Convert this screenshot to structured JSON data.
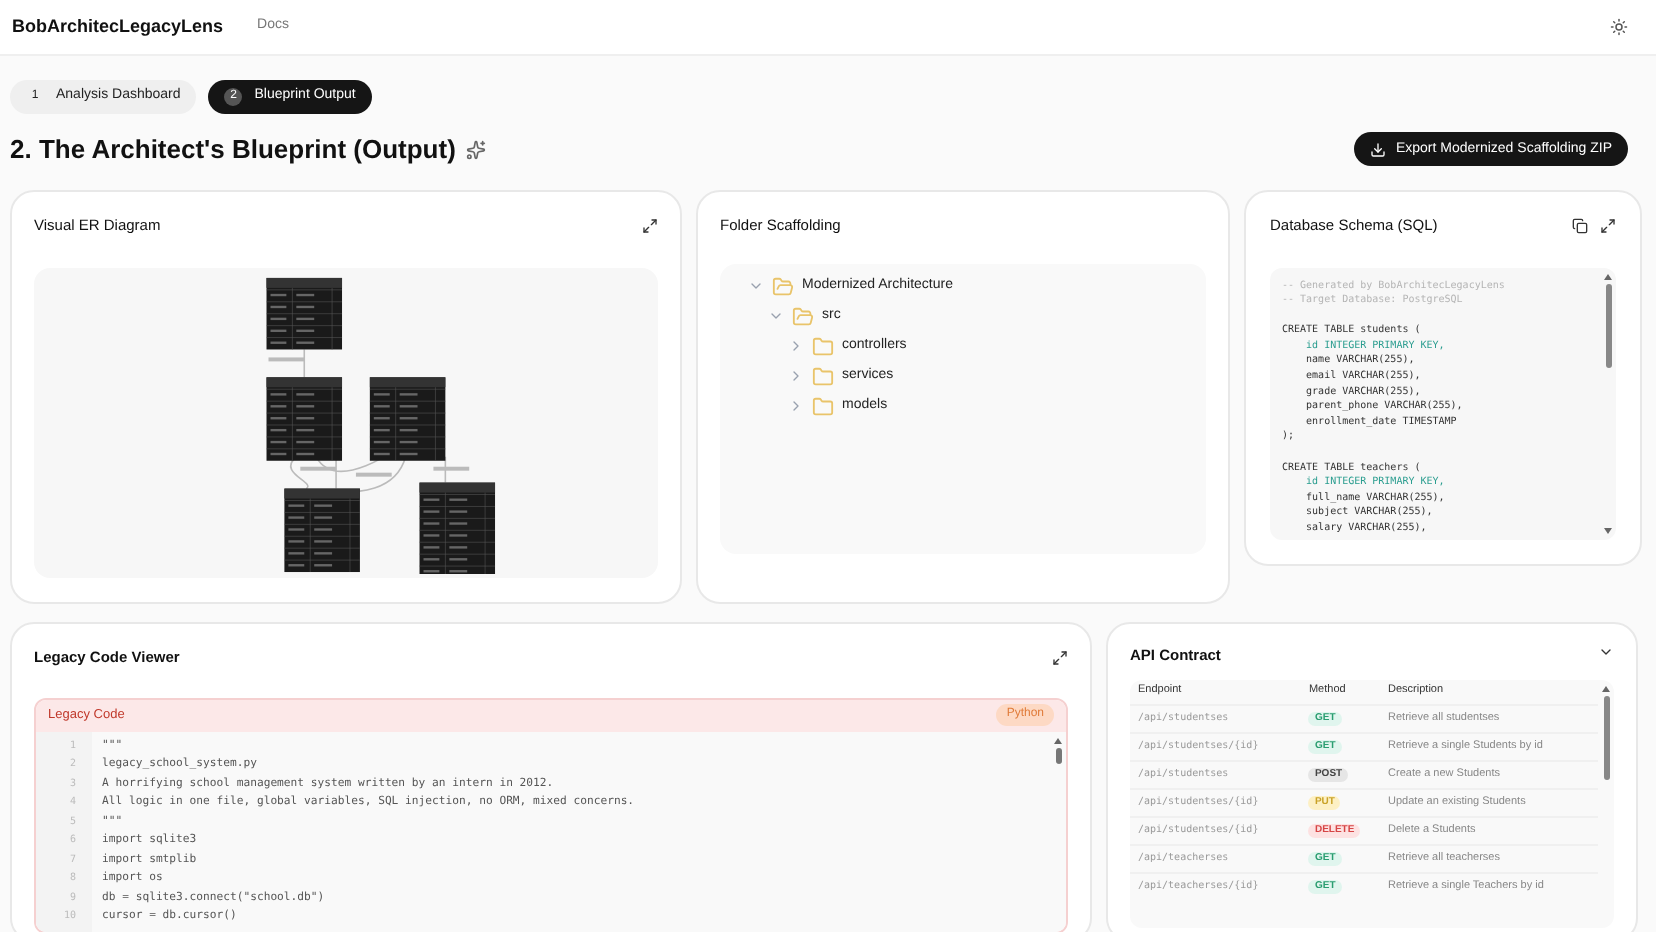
{
  "header": {
    "brand": "BobArchitecLegacyLens",
    "nav": [
      "Docs"
    ]
  },
  "steps": [
    {
      "number": "1",
      "label": "Analysis Dashboard",
      "selected": false
    },
    {
      "number": "2",
      "label": "Blueprint Output",
      "selected": true
    }
  ],
  "page_title": "2. The Architect's Blueprint (Output)",
  "export_button": "Export Modernized Scaffolding ZIP",
  "er_card": {
    "title": "Visual ER Diagram"
  },
  "folder_card": {
    "title": "Folder Scaffolding",
    "tree": [
      {
        "name": "Modernized Architecture",
        "expanded": true,
        "children": [
          {
            "name": "src",
            "expanded": true,
            "children": [
              {
                "name": "controllers",
                "expanded": false
              },
              {
                "name": "services",
                "expanded": false
              },
              {
                "name": "models",
                "expanded": false
              }
            ]
          }
        ]
      }
    ]
  },
  "sql_card": {
    "title": "Database Schema (SQL)",
    "lines": [
      {
        "kind": "comment",
        "text": "-- Generated by BobArchitecLegacyLens"
      },
      {
        "kind": "comment",
        "text": "-- Target Database: PostgreSQL"
      },
      {
        "kind": "blank"
      },
      {
        "kind": "code",
        "text": "CREATE TABLE students ("
      },
      {
        "kind": "key",
        "text": "    id INTEGER PRIMARY KEY,"
      },
      {
        "kind": "code",
        "text": "    name VARCHAR(255),"
      },
      {
        "kind": "code",
        "text": "    email VARCHAR(255),"
      },
      {
        "kind": "code",
        "text": "    grade VARCHAR(255),"
      },
      {
        "kind": "code",
        "text": "    parent_phone VARCHAR(255),"
      },
      {
        "kind": "code",
        "text": "    enrollment_date TIMESTAMP"
      },
      {
        "kind": "code",
        "text": ");"
      },
      {
        "kind": "blank"
      },
      {
        "kind": "code",
        "text": "CREATE TABLE teachers ("
      },
      {
        "kind": "key",
        "text": "    id INTEGER PRIMARY KEY,"
      },
      {
        "kind": "code",
        "text": "    full_name VARCHAR(255),"
      },
      {
        "kind": "code",
        "text": "    subject VARCHAR(255),"
      },
      {
        "kind": "code",
        "text": "    salary VARCHAR(255),"
      }
    ]
  },
  "code_card": {
    "title": "Legacy Code Viewer",
    "panel_label": "Legacy Code",
    "language": "Python",
    "lines": [
      {
        "number": "1",
        "text": "\"\"\""
      },
      {
        "number": "2",
        "text": "legacy_school_system.py"
      },
      {
        "number": "3",
        "text": "A horrifying school management system written by an intern in 2012."
      },
      {
        "number": "4",
        "text": "All logic in one file, global variables, SQL injection, no ORM, mixed concerns."
      },
      {
        "number": "5",
        "text": "\"\"\""
      },
      {
        "number": "6",
        "text": "import sqlite3"
      },
      {
        "number": "7",
        "text": "import smtplib"
      },
      {
        "number": "8",
        "text": "import os"
      },
      {
        "number": "9",
        "text": "db = sqlite3.connect(\"school.db\")"
      },
      {
        "number": "10",
        "text": "cursor = db.cursor()"
      }
    ]
  },
  "api_card": {
    "title": "API Contract",
    "expanded": true,
    "columns": [
      "Endpoint",
      "Method",
      "Description"
    ],
    "rows": [
      {
        "endpoint": "/api/studentses",
        "method": "GET",
        "kind": "get",
        "description": "Retrieve all studentses"
      },
      {
        "endpoint": "/api/studentses/{id}",
        "method": "GET",
        "kind": "get",
        "description": "Retrieve a single Students by id"
      },
      {
        "endpoint": "/api/studentses",
        "method": "POST",
        "kind": "post",
        "description": "Create a new Students"
      },
      {
        "endpoint": "/api/studentses/{id}",
        "method": "PUT",
        "kind": "put",
        "description": "Update an existing Students"
      },
      {
        "endpoint": "/api/studentses/{id}",
        "method": "DELETE",
        "kind": "delete",
        "description": "Delete a Students"
      },
      {
        "endpoint": "/api/teacherses",
        "method": "GET",
        "kind": "get",
        "description": "Retrieve all teacherses"
      },
      {
        "endpoint": "/api/teacherses/{id}",
        "method": "GET",
        "kind": "get",
        "description": "Retrieve a single Teachers by id"
      }
    ]
  }
}
